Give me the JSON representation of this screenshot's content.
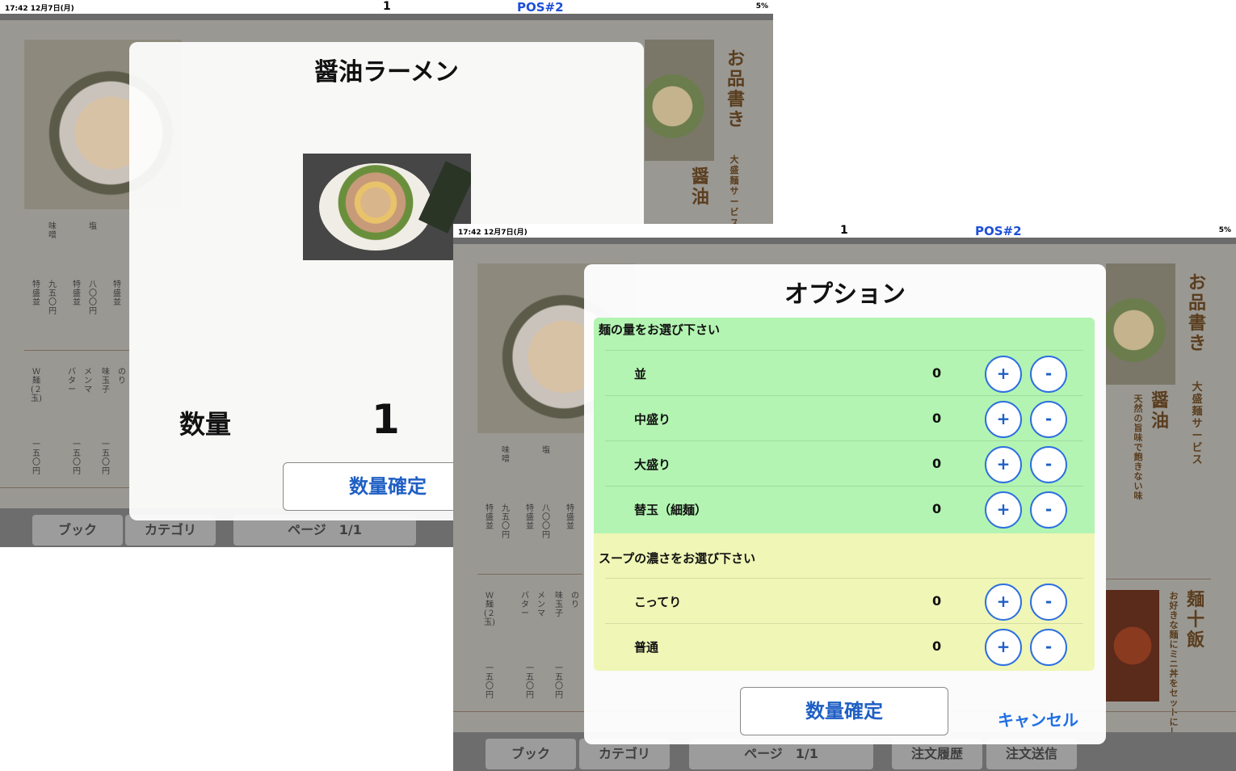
{
  "screen1": {
    "status": {
      "time": "17:42  12月7日(月)",
      "table_no": "1",
      "pos": "POS#2",
      "battery": "5%"
    },
    "modal": {
      "title": "醤油ラーメン",
      "qty_label": "数量",
      "qty_value": "1",
      "confirm_label": "数量確定"
    },
    "toolbar": {
      "book": "ブック",
      "category": "カテゴリ",
      "page": "ページ　1/1"
    }
  },
  "screen2": {
    "status": {
      "time": "17:42  12月7日(月)",
      "table_no": "1",
      "pos": "POS#2",
      "battery": "5%"
    },
    "modal": {
      "title": "オプション",
      "groups": [
        {
          "heading": "麺の量をお選び下さい",
          "options": [
            {
              "label": "並",
              "count": "0"
            },
            {
              "label": "中盛り",
              "count": "0"
            },
            {
              "label": "大盛り",
              "count": "0"
            },
            {
              "label": "替玉（細麺）",
              "count": "0"
            }
          ]
        },
        {
          "heading": "スープの濃さをお選び下さい",
          "options": [
            {
              "label": "こってり",
              "count": "0"
            },
            {
              "label": "普通",
              "count": "0"
            }
          ]
        }
      ],
      "plus": "+",
      "minus": "-",
      "confirm_label": "数量確定",
      "cancel_label": "キャンセル"
    },
    "toolbar": {
      "book": "ブック",
      "category": "カテゴリ",
      "page": "ページ　1/1",
      "history": "注文履歴",
      "send": "注文送信"
    }
  },
  "menu": {
    "title": "お品書き",
    "sub": "大盛麺サービス",
    "shoyu": "醤油",
    "shoyu_note": "天然の旨味で飽きない味",
    "men_meshi": "麺十飯",
    "men_meshi_note": "お好きな麺にミニ丼をセットにしました",
    "cols": [
      "味噌",
      "塩",
      "特盛並",
      "九五〇円",
      "八〇〇円",
      "Ｗ麺(２玉)",
      "バター",
      "メンマ",
      "味玉子",
      "のり",
      "一五〇円"
    ]
  },
  "colors": {
    "accent": "#1f5fc4",
    "pos": "#1e4fd8",
    "group1": "#b3f4b2",
    "group2": "#eff6b6"
  }
}
